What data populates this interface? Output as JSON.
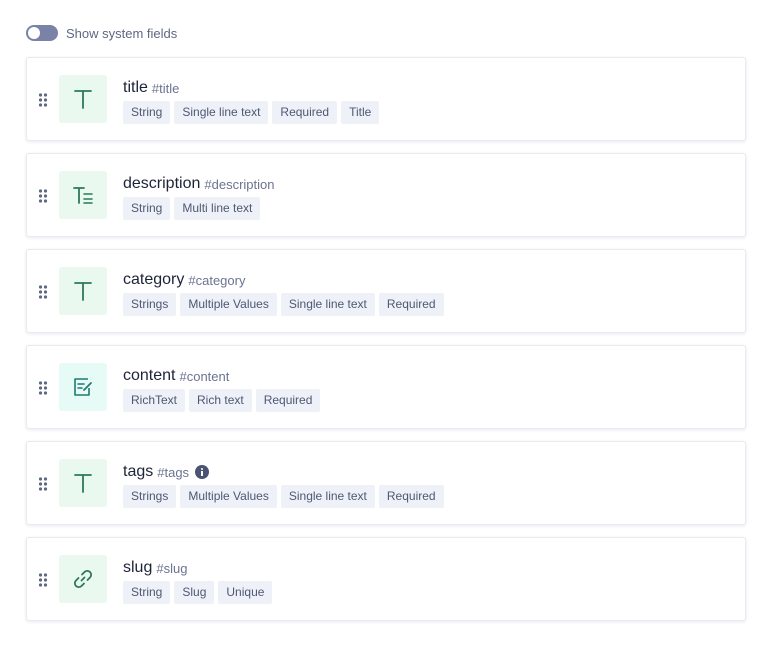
{
  "toggle": {
    "label": "Show system fields",
    "state": "off"
  },
  "fields": [
    {
      "name": "title",
      "id": "#title",
      "icon": "text-icon",
      "badges": [
        "String",
        "Single line text",
        "Required",
        "Title"
      ]
    },
    {
      "name": "description",
      "id": "#description",
      "icon": "multiline-text-icon",
      "badges": [
        "String",
        "Multi line text"
      ]
    },
    {
      "name": "category",
      "id": "#category",
      "icon": "text-icon",
      "badges": [
        "Strings",
        "Multiple Values",
        "Single line text",
        "Required"
      ]
    },
    {
      "name": "content",
      "id": "#content",
      "icon": "rich-text-icon",
      "badges": [
        "RichText",
        "Rich text",
        "Required"
      ]
    },
    {
      "name": "tags",
      "id": "#tags",
      "icon": "text-icon",
      "info_icon": "info-icon",
      "badges": [
        "Strings",
        "Multiple Values",
        "Single line text",
        "Required"
      ]
    },
    {
      "name": "slug",
      "id": "#slug",
      "icon": "link-icon",
      "badges": [
        "String",
        "Slug",
        "Unique"
      ]
    }
  ],
  "colors": {
    "toggle_off": "#7b82a8",
    "icon_bg_green": "#e9f9ef",
    "icon_bg_teal": "#e6fbf6",
    "icon_fg": "#2b7a57",
    "badge_bg": "#eef1f7"
  }
}
